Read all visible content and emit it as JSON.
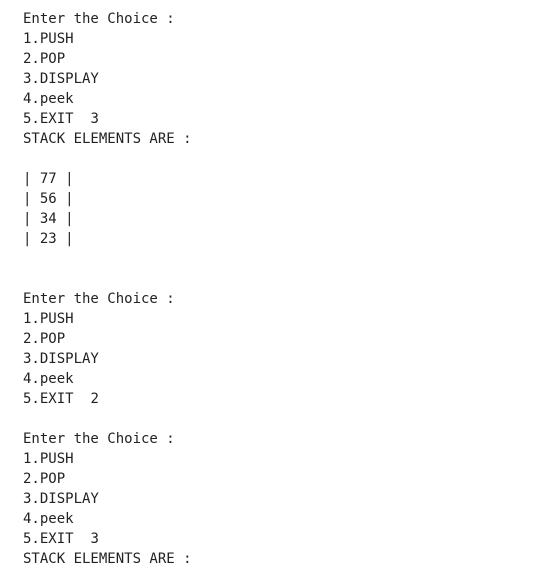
{
  "session_1": {
    "prompt": "Enter the Choice :",
    "options": [
      "1.PUSH",
      "2.POP",
      "3.DISPLAY",
      "4.peek"
    ],
    "exit_option": "5.EXIT",
    "input": "3",
    "result_header": "STACK ELEMENTS ARE :",
    "stack": [
      "| 77 |",
      "| 56 |",
      "| 34 |",
      "| 23 |"
    ]
  },
  "session_2": {
    "prompt": "Enter the Choice :",
    "options": [
      "1.PUSH",
      "2.POP",
      "3.DISPLAY",
      "4.peek"
    ],
    "exit_option": "5.EXIT",
    "input": "2"
  },
  "session_3": {
    "prompt": "Enter the Choice :",
    "options": [
      "1.PUSH",
      "2.POP",
      "3.DISPLAY",
      "4.peek"
    ],
    "exit_option": "5.EXIT",
    "input": "3",
    "result_header": "STACK ELEMENTS ARE :"
  }
}
